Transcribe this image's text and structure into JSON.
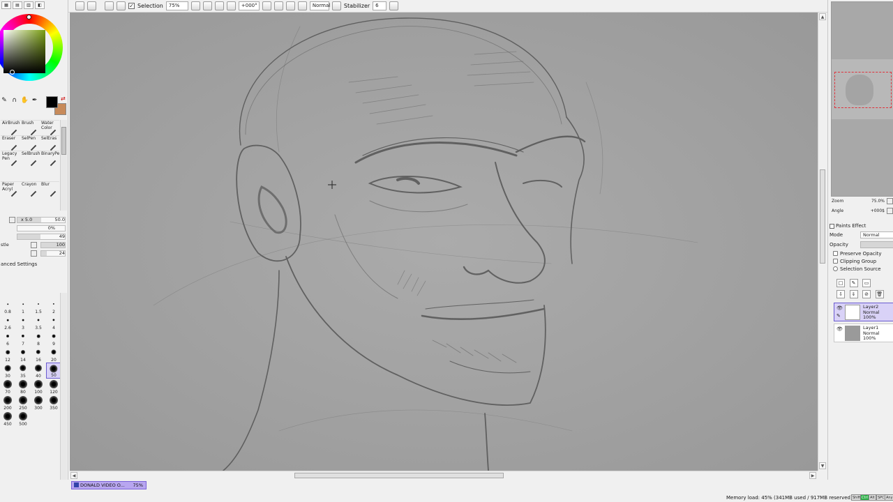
{
  "toolbar": {
    "selection_label": "Selection",
    "selection_checked": "✓",
    "zoom": "75%",
    "angle": "+000°",
    "blend": "Normal",
    "stabilizer_label": "Stabilizer",
    "stabilizer_value": "6"
  },
  "color": {
    "foreground": "#000000",
    "background": "#c78a5a",
    "swap_icon": "swap-icon"
  },
  "tools": [
    {
      "label": "AirBrush"
    },
    {
      "label": "Brush"
    },
    {
      "label": "Water Color"
    },
    {
      "label": "Eraser"
    },
    {
      "label": "SelPen"
    },
    {
      "label": "SelEras"
    },
    {
      "label": "Legacy Pen"
    },
    {
      "label": "SelBrush"
    },
    {
      "label": "BinaryPe"
    },
    {
      "label": ""
    },
    {
      "label": ""
    },
    {
      "label": ""
    },
    {
      "label": "Paper Acryl"
    },
    {
      "label": "Crayon"
    },
    {
      "label": "Blur"
    }
  ],
  "brush_settings": {
    "size_multiplier": "x 5.0",
    "size_value": "50.0",
    "min_size": "0%",
    "density": "49",
    "texture_label": "stle",
    "texture_value": "100",
    "blending_value": "24",
    "advanced_label": "anced Settings"
  },
  "brush_sizes": [
    "0.8",
    "1",
    "1.5",
    "2",
    "2.6",
    "3",
    "3.5",
    "4",
    "6",
    "7",
    "8",
    "9",
    "12",
    "14",
    "16",
    "20",
    "30",
    "35",
    "40",
    "50",
    "70",
    "80",
    "100",
    "120",
    "200",
    "250",
    "300",
    "350",
    "450",
    "500"
  ],
  "selected_brush_size": "50",
  "navigator": {
    "zoom_label": "Zoom",
    "zoom_value": "75.0%",
    "angle_label": "Angle",
    "angle_value": "+000$"
  },
  "layer_props": {
    "title": "Paints Effect",
    "mode_label": "Mode",
    "mode_value": "Normal",
    "opacity_label": "Opacity",
    "preserve_opacity": "Preserve Opacity",
    "clipping_group": "Clipping Group",
    "selection_source": "Selection Source"
  },
  "layers": [
    {
      "name": "Layer2",
      "mode": "Normal",
      "opacity": "100%",
      "selected": true
    },
    {
      "name": "Layer1",
      "mode": "Normal",
      "opacity": "100%",
      "selected": false
    }
  ],
  "document": {
    "name": "DONALD VIDEO O...",
    "zoom": "75%"
  },
  "status": {
    "memory": "Memory load: 45% (341MB used / 917MB reserved)",
    "keys": [
      "Shift",
      "Ctrl",
      "Alt",
      "SPC",
      "Any"
    ]
  }
}
